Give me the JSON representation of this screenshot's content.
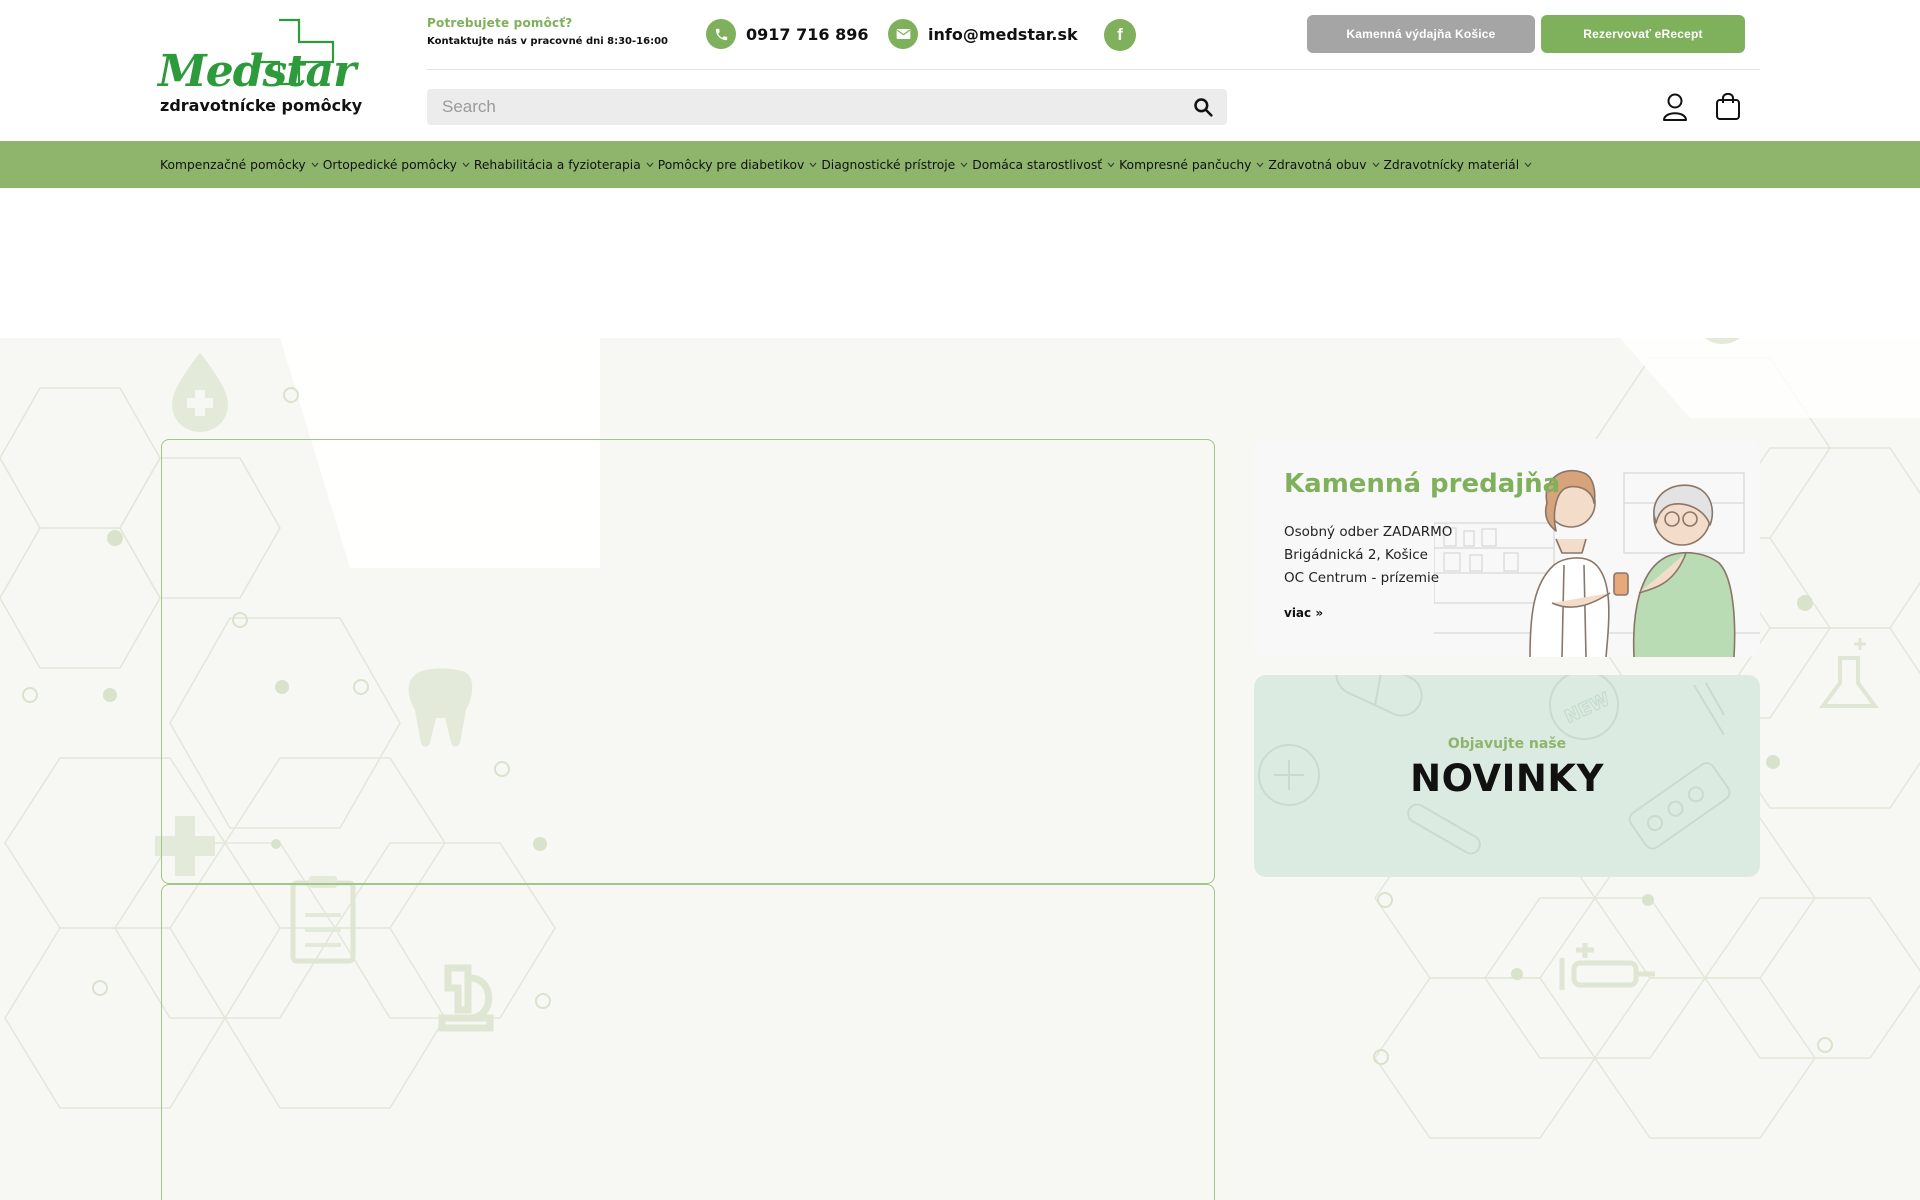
{
  "brand": {
    "name": "Medstar",
    "tagline": "zdravotnícke pomôcky",
    "color": "#2d9a3c"
  },
  "header": {
    "help_title": "Potrebujete pomôcť?",
    "help_subtitle": "Kontaktujte nás v pracovné dni 8:30-16:00",
    "phone": "0917 716 896",
    "email": "info@medstar.sk",
    "buttons": {
      "store": "Kamenná výdajňa Košice",
      "erecept": "Rezervovať eRecept"
    },
    "search": {
      "placeholder": "Search"
    }
  },
  "nav": {
    "items": [
      "Kompenzačné pomôcky",
      "Ortopedické pomôcky",
      "Rehabilitácia a fyzioterapia",
      "Pomôcky pre diabetikov",
      "Diagnostické prístroje",
      "Domáca starostlivosť",
      "Kompresné pančuchy",
      "Zdravotná obuv",
      "Zdravotnícky materiál"
    ]
  },
  "store_card": {
    "title": "Kamenná predajňa",
    "line1": "Osobný odber ZADARMO",
    "line2": "Brigádnická 2, Košice",
    "line3": "OC Centrum - prízemie",
    "more": "viac »"
  },
  "news_card": {
    "pre": "Objavujte naše",
    "title": "NOVINKY",
    "stamp": "NEW"
  },
  "colors": {
    "accent": "#7fb05b",
    "nav_bg": "#8fb56d",
    "grey_button": "#a5a5a5",
    "news_bg": "#dcebe1"
  }
}
